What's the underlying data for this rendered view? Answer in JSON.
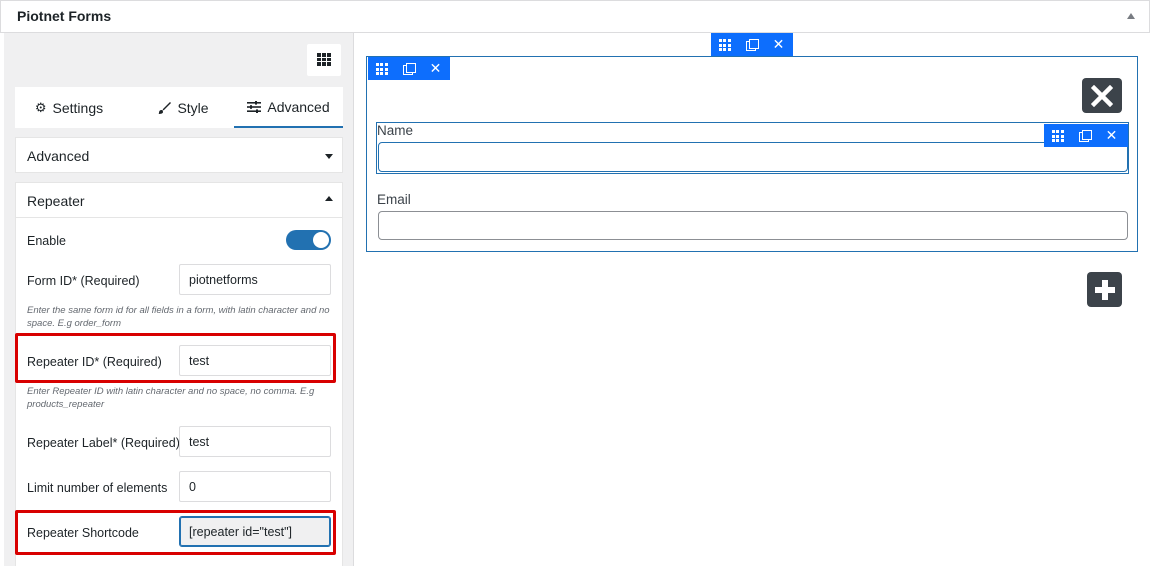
{
  "header": {
    "title": "Piotnet Forms"
  },
  "tabs": [
    {
      "label": "Settings",
      "icon": "gear-icon"
    },
    {
      "label": "Style",
      "icon": "brush-icon"
    },
    {
      "label": "Advanced",
      "icon": "sliders-icon"
    }
  ],
  "sections": {
    "advanced": {
      "title": "Advanced"
    },
    "repeater": {
      "title": "Repeater",
      "enable_label": "Enable",
      "enable_on": true,
      "form_id_label": "Form ID* (Required)",
      "form_id_value": "piotnetforms",
      "form_id_help": "Enter the same form id for all fields in a form, with latin character and no space. E.g order_form",
      "repeater_id_label": "Repeater ID* (Required)",
      "repeater_id_value": "test",
      "repeater_id_help": "Enter Repeater ID with latin character and no space, no comma. E.g products_repeater",
      "repeater_label_label": "Repeater Label* (Required)",
      "repeater_label_value": "test",
      "limit_label": "Limit number of elements",
      "limit_value": "0",
      "shortcode_label": "Repeater Shortcode",
      "shortcode_value": "[repeater id=\"test\"]"
    }
  },
  "canvas": {
    "name_label": "Name",
    "email_label": "Email",
    "remove_icon": "close-icon",
    "add_icon": "plus-icon"
  },
  "colors": {
    "accent": "#2271b1",
    "toolbar": "#0d6efd",
    "highlight": "#d80000"
  }
}
